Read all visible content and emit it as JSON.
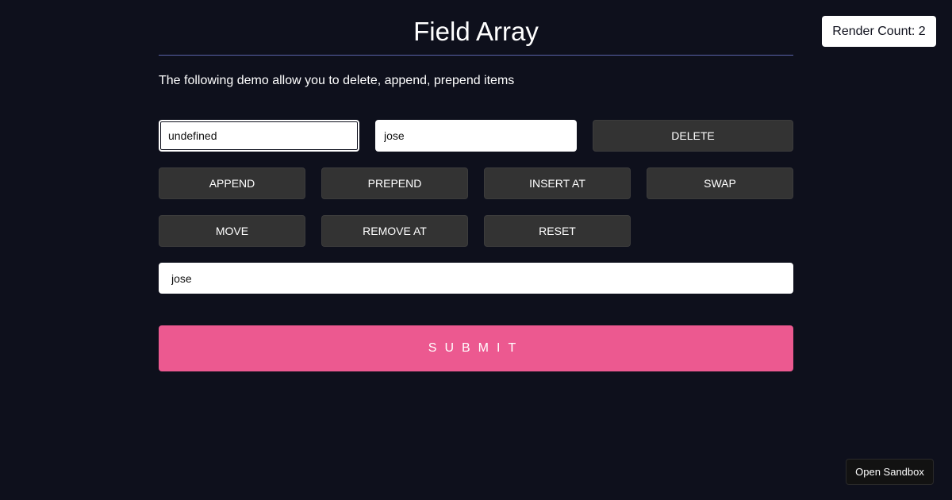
{
  "header": {
    "title": "Field Array",
    "render_count": "Render Count: 2"
  },
  "description": "The following demo allow you to delete, append, prepend items",
  "row": {
    "first_value": "undefined",
    "second_value": "jose",
    "delete_label": "DELETE"
  },
  "actions": {
    "append": "APPEND",
    "prepend": "PREPEND",
    "insert_at": "INSERT AT",
    "swap": "SWAP",
    "move": "MOVE",
    "remove_at": "REMOVE AT",
    "reset": "RESET"
  },
  "main_field_value": "jose",
  "submit_label": "SUBMIT",
  "sandbox_label": "Open Sandbox",
  "colors": {
    "background": "#0e101c",
    "submit": "#ec5990",
    "button": "#333333",
    "divider": "#5a63a8"
  }
}
